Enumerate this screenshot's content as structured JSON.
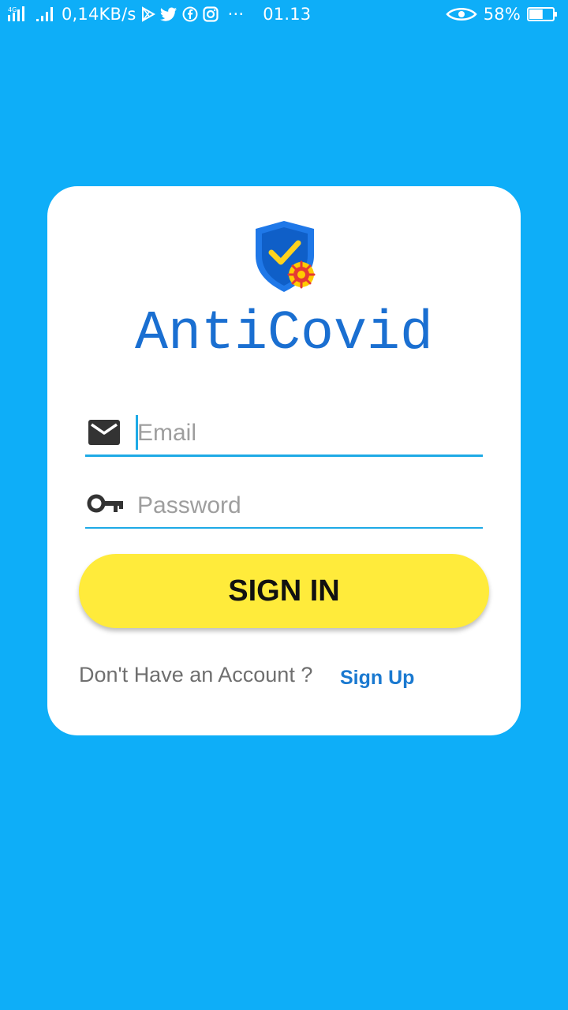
{
  "status_bar": {
    "network_type": "4G",
    "speed": "0,14KB/s",
    "overflow": "···",
    "time": "01.13",
    "battery": "58%",
    "battery_level": 0.58
  },
  "app": {
    "title": "AntiCovid"
  },
  "login": {
    "email_placeholder": "Email",
    "password_placeholder": "Password",
    "signin_label": "SIGN IN",
    "no_account_text": "Don't Have an Account ?",
    "signup_label": "Sign Up"
  },
  "colors": {
    "background": "#0eaef8",
    "card": "#ffffff",
    "title": "#1a6fd1",
    "button": "#ffeb3b",
    "underline": "#1eaae6",
    "link": "#1a79d0"
  },
  "icons": {
    "logo": "shield-check-virus-icon",
    "email": "envelope-icon",
    "password": "key-icon"
  }
}
